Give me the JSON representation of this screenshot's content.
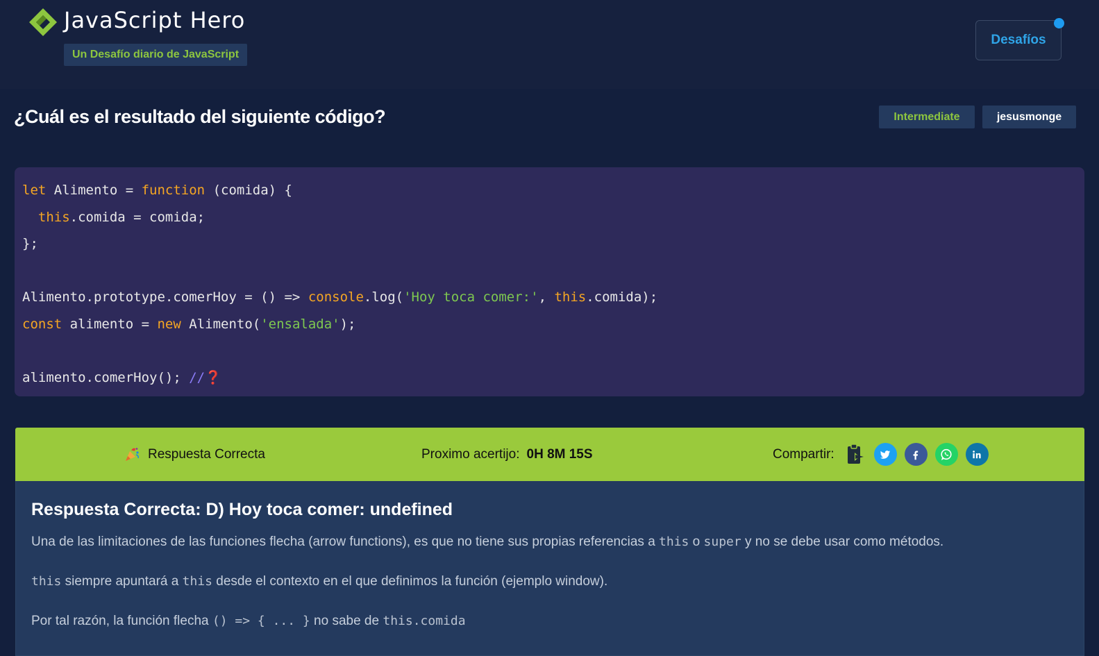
{
  "header": {
    "brand_title": "JavaScript Hero",
    "tagline": "Un Desafío diario de JavaScript",
    "nav_button": "Desafíos",
    "logo_icon": "diamond-logo-icon",
    "accent_color": "#8dc63f",
    "nav_color": "#2fa4e7"
  },
  "question": {
    "title": "¿Cuál es el resultado del siguiente código?",
    "level": "Intermediate",
    "author": "jesusmonge"
  },
  "code": {
    "line1": {
      "kw1": "let",
      "t1": " Alimento = ",
      "kw2": "function",
      "t2": " (comida) {"
    },
    "line2": {
      "t0": "  ",
      "kw1": "this",
      "t1": ".comida = comida;"
    },
    "line3": {
      "t1": "};"
    },
    "line5": {
      "t1": "Alimento.prototype.comerHoy = () => ",
      "kw1": "console",
      "t2": ".log(",
      "s1": "'Hoy toca comer:'",
      "t3": ", ",
      "kw2": "this",
      "t4": ".comida);"
    },
    "line6": {
      "kw1": "const",
      "t1": " alimento = ",
      "kw2": "new",
      "t2": " Alimento(",
      "s1": "'ensalada'",
      "t3": ");"
    },
    "line8": {
      "t1": "alimento.comerHoy(); ",
      "c1": "//",
      "emoji": "❓"
    }
  },
  "result": {
    "status": "Respuesta Correcta",
    "status_icon": "party-popper-icon",
    "timer_label": "Proximo acertijo:",
    "timer_value": "0H 8M 15S",
    "share_label": "Compartir:",
    "share_icons": [
      "clipboard-icon",
      "twitter-icon",
      "facebook-icon",
      "whatsapp-icon",
      "linkedin-icon"
    ],
    "bar_color": "#9aca3c"
  },
  "explanation": {
    "title": "Respuesta Correcta: D) Hoy toca comer: undefined",
    "p1": {
      "a": "Una de las limitaciones de las funciones flecha (arrow functions), es que no tiene sus propias referencias a ",
      "code1": "this",
      "b": " o ",
      "code2": "super",
      "c": " y no se debe usar como métodos."
    },
    "p2": {
      "code1": "this",
      "a": " siempre apuntará a ",
      "code2": "this",
      "b": " desde el contexto en el que definimos la función (ejemplo window)."
    },
    "p3": {
      "a": "Por tal razón, la función flecha ",
      "code1": "() => { ... }",
      "b": " no sabe de ",
      "code2": "this.comida"
    }
  }
}
